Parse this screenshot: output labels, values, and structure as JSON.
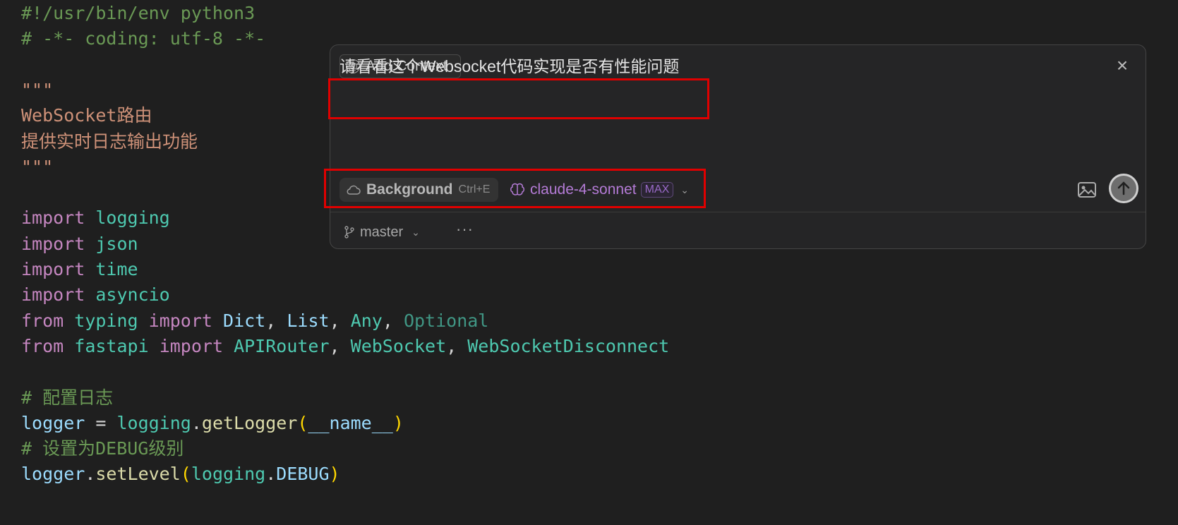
{
  "code": {
    "lines": [
      [
        {
          "t": "#!/usr/bin/env python3",
          "c": "comment"
        }
      ],
      [
        {
          "t": "# -*- coding: utf-8 -*-",
          "c": "comment"
        }
      ],
      [],
      [
        {
          "t": "\"\"\"",
          "c": "string"
        }
      ],
      [
        {
          "t": "WebSocket路由",
          "c": "string"
        }
      ],
      [
        {
          "t": "提供实时日志输出功能",
          "c": "string"
        }
      ],
      [
        {
          "t": "\"\"\"",
          "c": "string"
        }
      ],
      [],
      [
        {
          "t": "import",
          "c": "keyword"
        },
        {
          "t": " ",
          "c": "plain"
        },
        {
          "t": "logging",
          "c": "module"
        }
      ],
      [
        {
          "t": "import",
          "c": "keyword"
        },
        {
          "t": " ",
          "c": "plain"
        },
        {
          "t": "json",
          "c": "module"
        }
      ],
      [
        {
          "t": "import",
          "c": "keyword"
        },
        {
          "t": " ",
          "c": "plain"
        },
        {
          "t": "time",
          "c": "module"
        }
      ],
      [
        {
          "t": "import",
          "c": "keyword"
        },
        {
          "t": " ",
          "c": "plain"
        },
        {
          "t": "asyncio",
          "c": "module"
        }
      ],
      [
        {
          "t": "from",
          "c": "keyword"
        },
        {
          "t": " ",
          "c": "plain"
        },
        {
          "t": "typing",
          "c": "module"
        },
        {
          "t": " ",
          "c": "plain"
        },
        {
          "t": "import",
          "c": "keyword"
        },
        {
          "t": " ",
          "c": "plain"
        },
        {
          "t": "Dict",
          "c": "var"
        },
        {
          "t": ", ",
          "c": "plain"
        },
        {
          "t": "List",
          "c": "var"
        },
        {
          "t": ", ",
          "c": "plain"
        },
        {
          "t": "Any",
          "c": "type"
        },
        {
          "t": ", ",
          "c": "plain"
        },
        {
          "t": "Optional",
          "c": "dim"
        }
      ],
      [
        {
          "t": "from",
          "c": "keyword"
        },
        {
          "t": " ",
          "c": "plain"
        },
        {
          "t": "fastapi",
          "c": "module"
        },
        {
          "t": " ",
          "c": "plain"
        },
        {
          "t": "import",
          "c": "keyword"
        },
        {
          "t": " ",
          "c": "plain"
        },
        {
          "t": "APIRouter",
          "c": "type"
        },
        {
          "t": ", ",
          "c": "plain"
        },
        {
          "t": "WebSocket",
          "c": "type"
        },
        {
          "t": ", ",
          "c": "plain"
        },
        {
          "t": "WebSocketDisconnect",
          "c": "type"
        }
      ],
      [],
      [
        {
          "t": "# 配置日志",
          "c": "comment"
        }
      ],
      [
        {
          "t": "logger",
          "c": "var"
        },
        {
          "t": " = ",
          "c": "plain"
        },
        {
          "t": "logging",
          "c": "module"
        },
        {
          "t": ".",
          "c": "plain"
        },
        {
          "t": "getLogger",
          "c": "fn"
        },
        {
          "t": "(",
          "c": "paren"
        },
        {
          "t": "__name__",
          "c": "var"
        },
        {
          "t": ")",
          "c": "paren"
        }
      ],
      [
        {
          "t": "# 设置为DEBUG级别",
          "c": "comment"
        }
      ],
      [
        {
          "t": "logger",
          "c": "var"
        },
        {
          "t": ".",
          "c": "plain"
        },
        {
          "t": "setLevel",
          "c": "fn"
        },
        {
          "t": "(",
          "c": "paren"
        },
        {
          "t": "logging",
          "c": "module"
        },
        {
          "t": ".",
          "c": "plain"
        },
        {
          "t": "DEBUG",
          "c": "var"
        },
        {
          "t": ")",
          "c": "paren"
        }
      ]
    ]
  },
  "chat": {
    "add_context_label": "Add Context",
    "close_icon": "close-icon",
    "prompt": "请看看这个Websocket代码实现是否有性能问题",
    "background_label": "Background",
    "background_shortcut": "Ctrl+E",
    "model_name": "claude-4-sonnet",
    "model_badge": "MAX",
    "branch": "master",
    "more": "···",
    "highlight_color": "#e00000",
    "model_color": "#b47bd6"
  }
}
